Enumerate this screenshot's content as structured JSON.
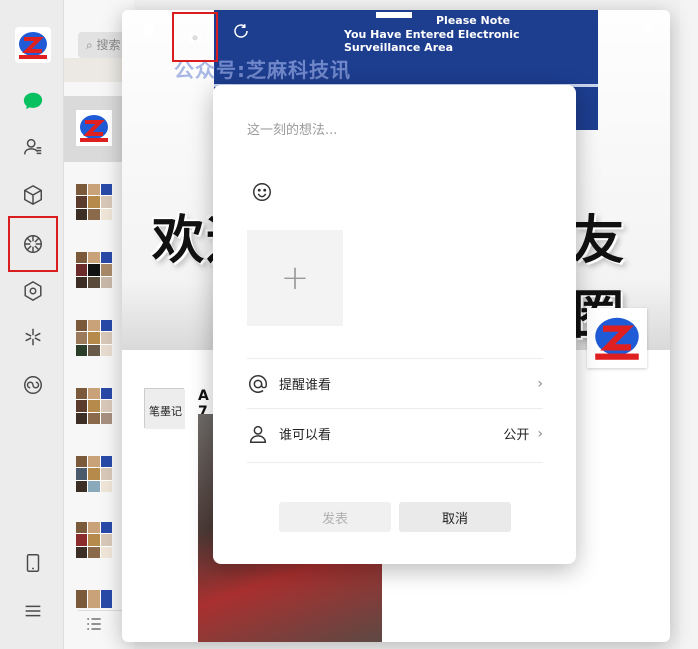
{
  "search": {
    "placeholder": "搜索"
  },
  "moments": {
    "banner_note_1": "Please Note",
    "banner_note_2": "You Have Entered Electronic Surveillance Area",
    "watermark": "公众号:芝麻科技讯",
    "welcome_left": "欢迎",
    "welcome_right": "友圈",
    "post_author": "A 7"
  },
  "composer": {
    "placeholder": "这一刻的想法...",
    "add_image": "+",
    "remind_label": "提醒谁看",
    "visibility_label": "谁可以看",
    "visibility_value": "公开",
    "publish_button": "发表",
    "cancel_button": "取消"
  },
  "colors": {
    "highlight_border": "#d81e1e",
    "banner_blue": "#1d3d8f",
    "chat_green": "#07c160"
  }
}
